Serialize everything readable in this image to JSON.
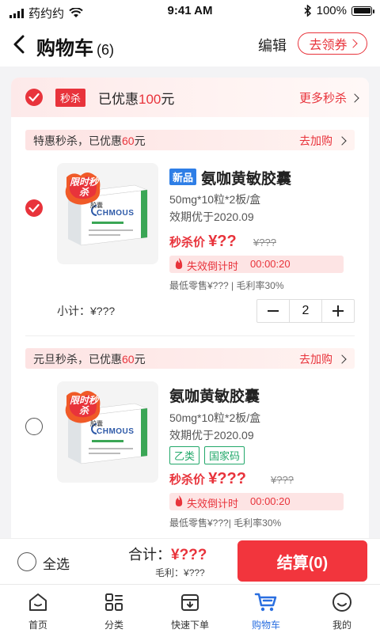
{
  "status_bar": {
    "carrier": "药约约",
    "time": "9:41 AM",
    "battery": "100%"
  },
  "nav": {
    "title": "购物车",
    "count": "(6)",
    "edit_label": "编辑",
    "coupon_label": "去领券"
  },
  "seckill_header": {
    "tag": "秒杀",
    "saved_prefix": "已优惠",
    "saved_amount": "100",
    "saved_suffix": "元",
    "more_label": "更多秒杀"
  },
  "groups": [
    {
      "promo_prefix": "特惠秒杀，已优惠",
      "promo_amount": "60",
      "promo_suffix": "元",
      "action_label": "去加购",
      "product": {
        "new_tag": "新品",
        "name": "氨咖黄敏胶囊",
        "spec": "50mg*10粒*2板/盒",
        "expiry": "效期优于2020.09",
        "price_label": "秒杀价",
        "price": "¥??",
        "old_price": "¥???",
        "countdown_label": "失效倒计时",
        "countdown_time": "00:00:20",
        "meta": "最低零售¥??? | 毛利率30%",
        "badge_text": "限时秒杀",
        "brand": "CHMOUS",
        "box_label": "胶囊",
        "checked": true
      },
      "subtotal": "小计：¥???",
      "quantity": "2"
    },
    {
      "promo_prefix": "元旦秒杀，已优惠",
      "promo_amount": "60",
      "promo_suffix": "元",
      "action_label": "去加购",
      "product": {
        "name": "氨咖黄敏胶囊",
        "spec": "50mg*10粒*2板/盒",
        "expiry": "效期优于2020.09",
        "tags": [
          "乙类",
          "国家码"
        ],
        "price_label": "秒杀价",
        "price": "¥???",
        "old_price": "¥???",
        "countdown_label": "失效倒计时",
        "countdown_time": "00:00:20",
        "meta": "最低零售¥???| 毛利率30%",
        "badge_text": "限时秒杀",
        "brand": "CHMOUS",
        "box_label": "胶囊",
        "checked": false
      }
    }
  ],
  "checkout": {
    "select_all": "全选",
    "total_label": "合计：",
    "total_amount": "¥???",
    "margin_label": "毛利：",
    "margin_amount": "¥???",
    "pay_label": "结算(0)"
  },
  "tabs": [
    {
      "label": "首页",
      "icon": "home-icon"
    },
    {
      "label": "分类",
      "icon": "category-icon"
    },
    {
      "label": "快速下单",
      "icon": "quick-order-icon"
    },
    {
      "label": "购物车",
      "icon": "cart-icon",
      "active": true
    },
    {
      "label": "我的",
      "icon": "profile-icon"
    }
  ],
  "colors": {
    "accent_red": "#e8333b",
    "active_blue": "#2a6fe0",
    "tag_green": "#22a86a",
    "new_tag_blue": "#2e7ee6"
  }
}
